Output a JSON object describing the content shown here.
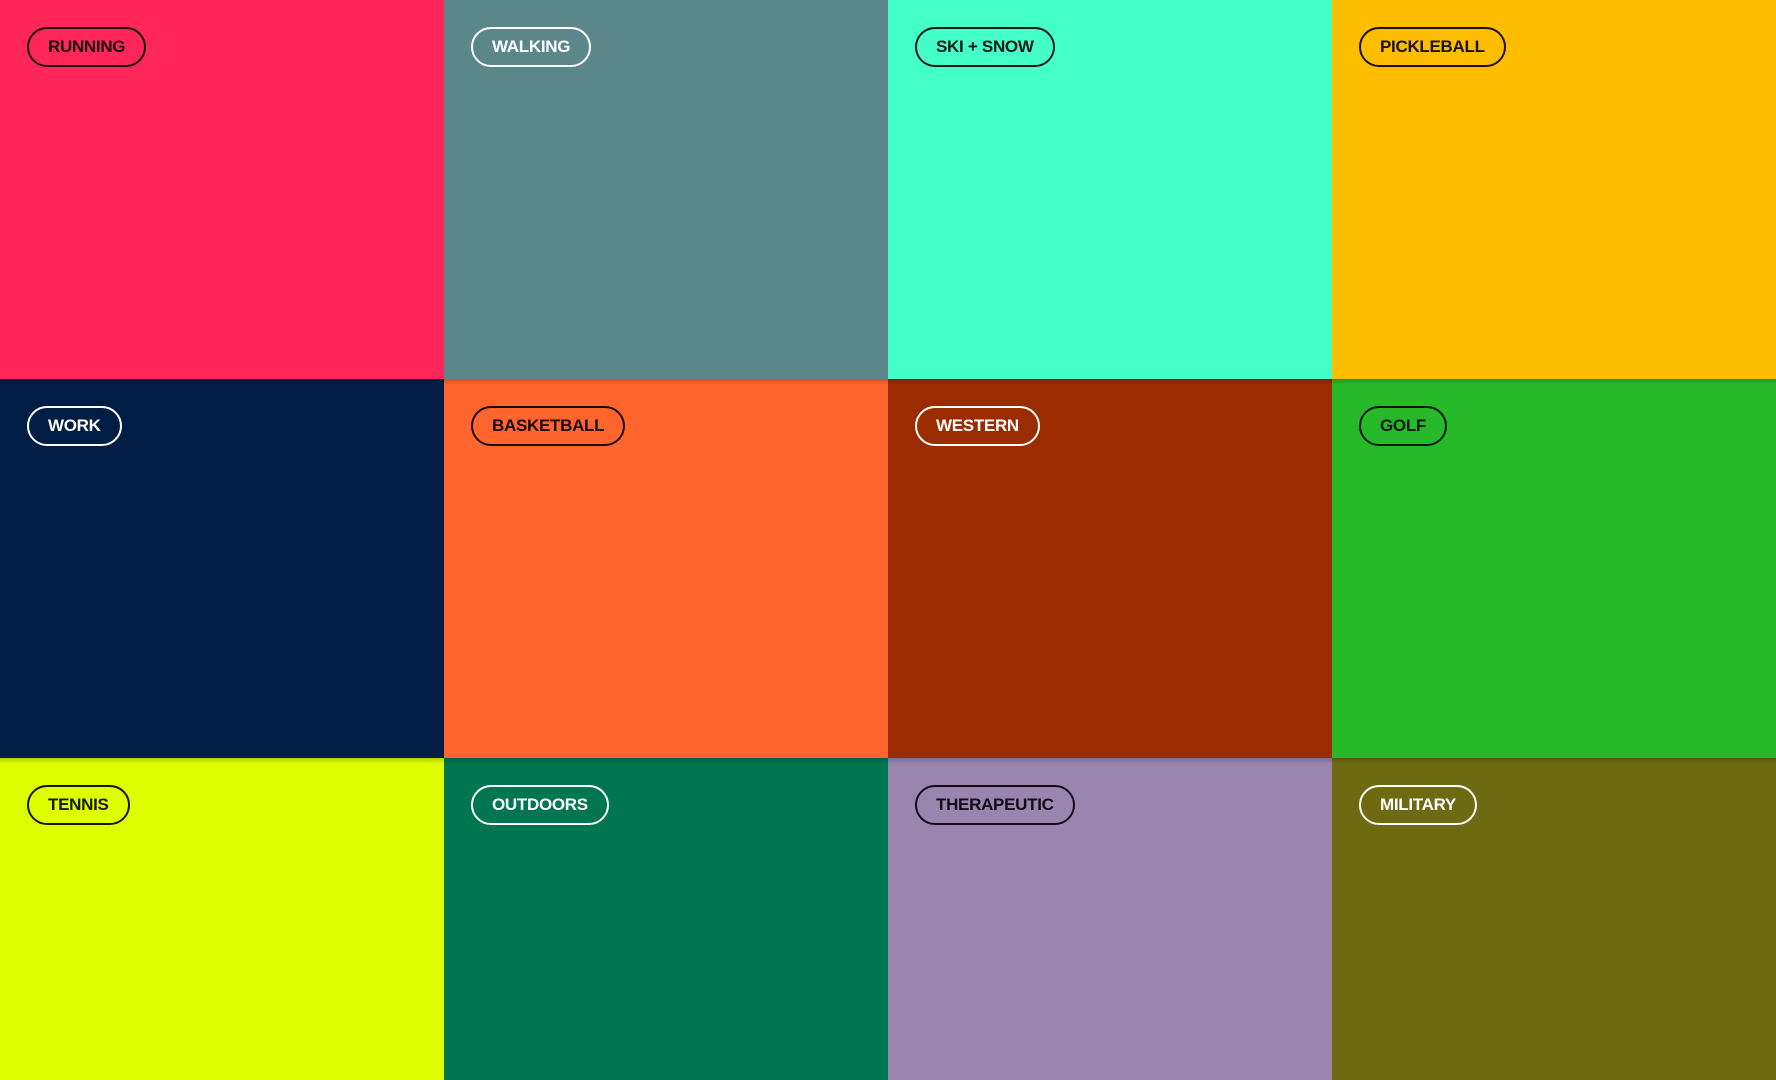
{
  "categories": [
    {
      "id": "running",
      "label": "RUNNING",
      "bg": "#FF2759",
      "fg": "#1A0A10"
    },
    {
      "id": "walking",
      "label": "WALKING",
      "bg": "#5B878A",
      "fg": "#FFFFFF"
    },
    {
      "id": "ski-snow",
      "label": "SKI + SNOW",
      "bg": "#45FFC8",
      "fg": "#0A1A14"
    },
    {
      "id": "pickleball",
      "label": "PICKLEBALL",
      "bg": "#FFBD00",
      "fg": "#1A1200"
    },
    {
      "id": "work",
      "label": "WORK",
      "bg": "#001E45",
      "fg": "#FFFFFF"
    },
    {
      "id": "basketball",
      "label": "BASKETBALL",
      "bg": "#FF652D",
      "fg": "#1A0A04"
    },
    {
      "id": "western",
      "label": "WESTERN",
      "bg": "#9B2C00",
      "fg": "#FFFFFF"
    },
    {
      "id": "golf",
      "label": "GOLF",
      "bg": "#28B92A",
      "fg": "#061A06"
    },
    {
      "id": "tennis",
      "label": "TENNIS",
      "bg": "#DDFF00",
      "fg": "#141800"
    },
    {
      "id": "outdoors",
      "label": "OUTDOORS",
      "bg": "#007650",
      "fg": "#FFFFFF"
    },
    {
      "id": "therapeutic",
      "label": "THERAPEUTIC",
      "bg": "#9985AE",
      "fg": "#120C1A"
    },
    {
      "id": "military",
      "label": "MILITARY",
      "bg": "#6E6A12",
      "fg": "#FFFFFF"
    }
  ]
}
